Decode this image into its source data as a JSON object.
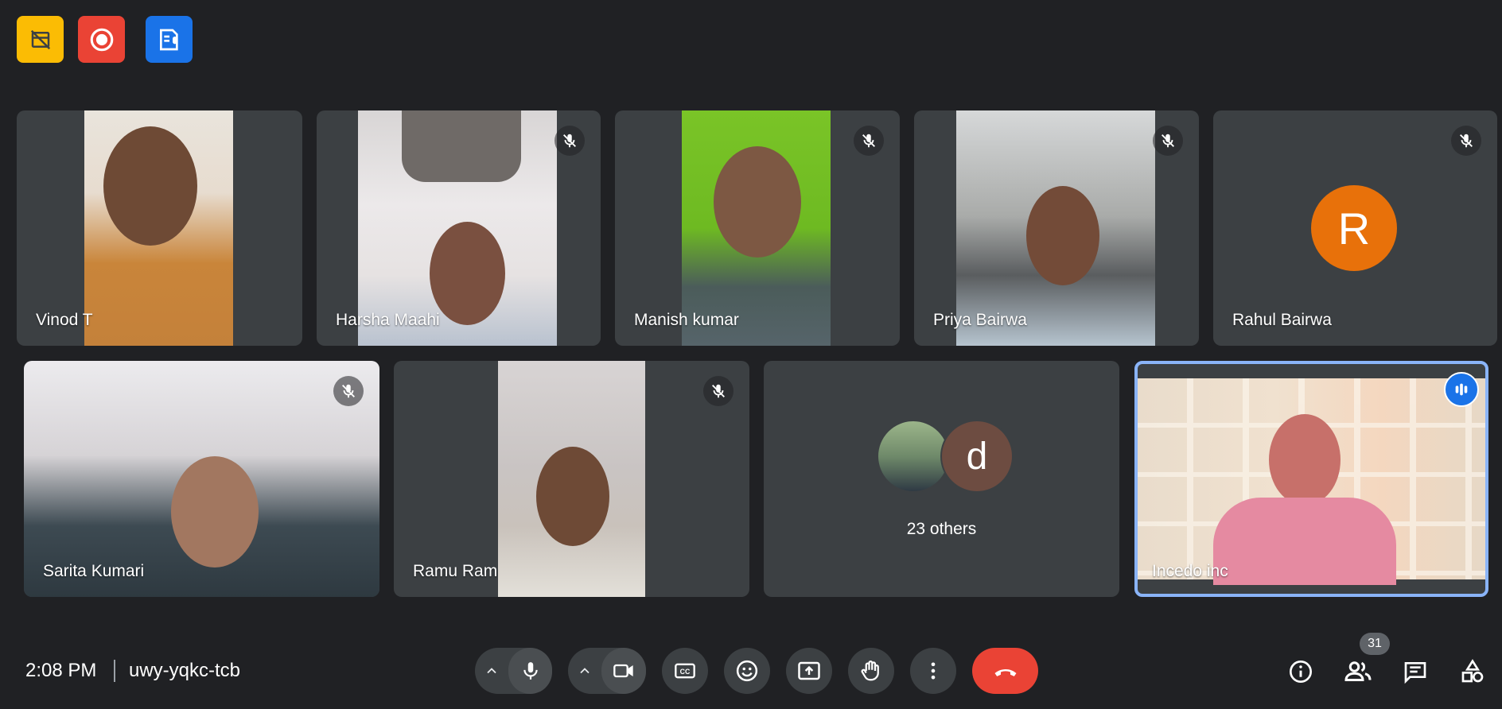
{
  "meeting": {
    "time": "2:08 PM",
    "code": "uwy-yqkc-tcb"
  },
  "participants": [
    {
      "name": "Vinod T"
    },
    {
      "name": "Harsha Maahi"
    },
    {
      "name": "Manish kumar"
    },
    {
      "name": "Priya Bairwa"
    },
    {
      "name": "Rahul Bairwa",
      "avatar_letter": "R"
    },
    {
      "name": "Sarita Kumari"
    },
    {
      "name": "Ramu Ram"
    },
    {
      "name": "Incedo inc"
    }
  ],
  "others": {
    "label": "23 others",
    "avatar_letter": "d"
  },
  "people_count": "31",
  "colors": {
    "background": "#202124",
    "tile": "#3c4043",
    "end_call": "#ea4335",
    "active_speaker": "#8ab4f8",
    "accent_blue": "#1a73e8",
    "record_red": "#ea4335",
    "warning_yellow": "#fbbc04",
    "rahul_avatar": "#e8710a",
    "others_avatar": "#6d4c41"
  },
  "icons": {
    "top": [
      "no-video-layout-icon",
      "record-icon",
      "transcript-icon"
    ],
    "controls": [
      "chevron-up-icon",
      "microphone-icon",
      "camera-icon",
      "captions-icon",
      "emoji-icon",
      "present-icon",
      "raise-hand-icon",
      "more-vert-icon",
      "end-call-icon"
    ],
    "right": [
      "info-icon",
      "people-icon",
      "chat-icon",
      "activities-icon"
    ]
  }
}
